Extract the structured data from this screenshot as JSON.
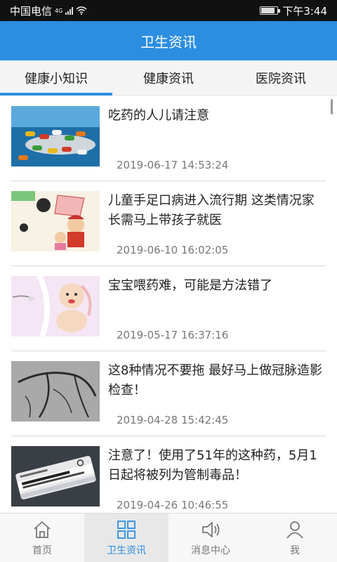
{
  "status": {
    "carrier": "中国电信",
    "network": "4G",
    "time": "下午3:44",
    "battery_level": 0.85
  },
  "header": {
    "title": "卫生资讯"
  },
  "tabs": [
    {
      "label": "健康小知识",
      "active": true
    },
    {
      "label": "健康资讯",
      "active": false
    },
    {
      "label": "医院资讯",
      "active": false
    }
  ],
  "articles": [
    {
      "title": "吃药的人儿请注意",
      "time": "2019-06-17 14:53:24",
      "thumb": "pills-on-spoon"
    },
    {
      "title": "儿童手足口病进入流行期 这类情况家长需马上带孩子就医",
      "time": "2019-06-10 16:02:05",
      "thumb": "cartoon-child-virus"
    },
    {
      "title": "宝宝喂药难，可能是方法错了",
      "time": "2019-05-17 16:37:16",
      "thumb": "cartoon-baby-medicine"
    },
    {
      "title": "这8种情况不要拖 最好马上做冠脉造影检查！",
      "time": "2019-04-28 15:42:45",
      "thumb": "angiogram-xray"
    },
    {
      "title": "注意了！使用了51年的这种药，5月1日起将被列为管制毒品！",
      "time": "2019-04-26 10:46:55",
      "thumb": "fentanyl-vial"
    }
  ],
  "nav": [
    {
      "label": "首页",
      "icon": "home-icon",
      "active": false
    },
    {
      "label": "卫生资讯",
      "icon": "grid-icon",
      "active": true
    },
    {
      "label": "消息中心",
      "icon": "speaker-icon",
      "active": false
    },
    {
      "label": "我",
      "icon": "user-icon",
      "active": false
    }
  ],
  "colors": {
    "accent": "#2c8ee0",
    "status_bar": "#111111"
  }
}
